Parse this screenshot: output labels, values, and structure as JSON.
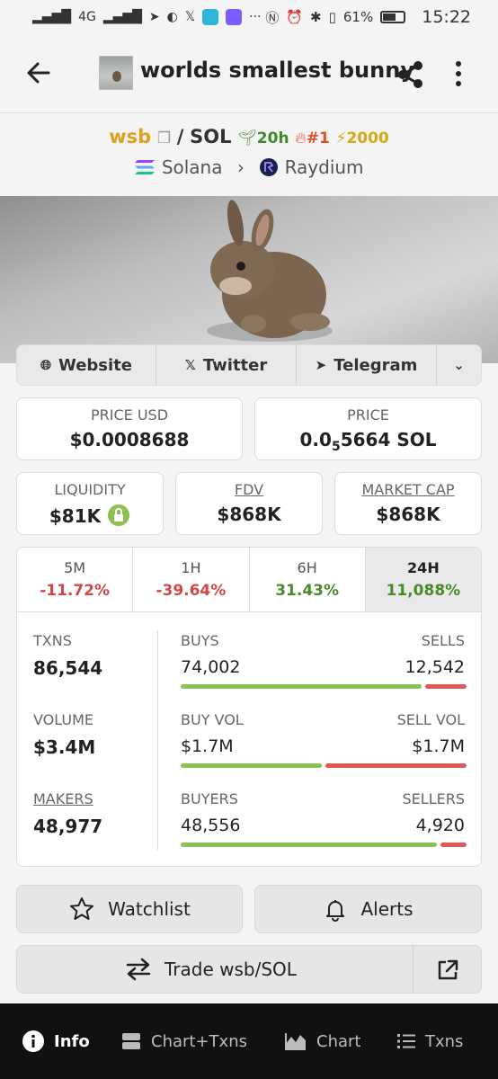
{
  "status_bar": {
    "network": "4G",
    "battery": "61%",
    "time": "15:22"
  },
  "header": {
    "title": "worlds smallest bunny"
  },
  "pair": {
    "symbol": "wsb",
    "quote": "SOL",
    "age": "20h",
    "rank": "#1",
    "boost": "2000",
    "chain": "Solana",
    "dex": "Raydium"
  },
  "links": {
    "website": "Website",
    "twitter": "Twitter",
    "telegram": "Telegram"
  },
  "price": {
    "usd_label": "PRICE USD",
    "usd_value": "$0.0008688",
    "native_label": "PRICE",
    "native_prefix": "0.0",
    "native_sub": "5",
    "native_suffix": "5664 SOL"
  },
  "metrics": {
    "liquidity_label": "LIQUIDITY",
    "liquidity_value": "$81K",
    "fdv_label": "FDV",
    "fdv_value": "$868K",
    "mcap_label": "MARKET CAP",
    "mcap_value": "$868K"
  },
  "timeframes": [
    {
      "label": "5M",
      "value": "-11.72%",
      "trend": "neg"
    },
    {
      "label": "1H",
      "value": "-39.64%",
      "trend": "neg"
    },
    {
      "label": "6H",
      "value": "31.43%",
      "trend": "pos"
    },
    {
      "label": "24H",
      "value": "11,088%",
      "trend": "pos",
      "active": true
    }
  ],
  "stats": {
    "txns_label": "TXNS",
    "txns_value": "86,544",
    "buys_label": "BUYS",
    "buys_value": "74,002",
    "sells_label": "SELLS",
    "sells_value": "12,542",
    "buys_share": 0.855,
    "volume_label": "VOLUME",
    "volume_value": "$3.4M",
    "buyvol_label": "BUY VOL",
    "buyvol_value": "$1.7M",
    "sellvol_label": "SELL VOL",
    "sellvol_value": "$1.7M",
    "buyvol_share": 0.5,
    "makers_label": "MAKERS",
    "makers_value": "48,977",
    "buyers_label": "BUYERS",
    "buyers_value": "48,556",
    "sellers_label": "SELLERS",
    "sellers_value": "4,920",
    "buyers_share": 0.908
  },
  "actions": {
    "watchlist": "Watchlist",
    "alerts": "Alerts",
    "trade": "Trade wsb/SOL"
  },
  "bottom_nav": {
    "info": "Info",
    "chart_txns": "Chart+Txns",
    "chart": "Chart",
    "txns": "Txns"
  }
}
